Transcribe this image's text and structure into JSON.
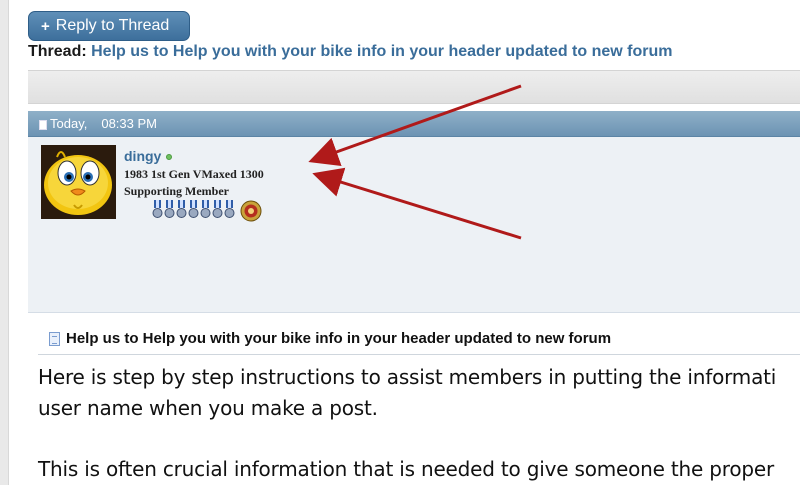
{
  "toolbar": {
    "reply_label": "Reply to Thread"
  },
  "thread": {
    "label": "Thread:",
    "title": "Help us to Help you with your bike info in your header updated to new forum"
  },
  "post": {
    "date": "Today,",
    "time": "08:33 PM",
    "user": {
      "name": "dingy",
      "title": "1983 1st Gen VMaxed 1300",
      "rank": "Supporting Member",
      "online": true,
      "medals_count": 7
    },
    "title": "Help us to Help you with your bike info in your header updated to new forum",
    "body_lines": [
      "Here is step by step instructions to assist members in putting the informati",
      "user name when you make a post.",
      "",
      "This is often crucial information that is needed to give someone the proper"
    ]
  },
  "colors": {
    "accent": "#3a6d9a",
    "header_bar": "#6c93b3",
    "annotation_arrow": "#b01a1a",
    "online": "#70c060"
  }
}
